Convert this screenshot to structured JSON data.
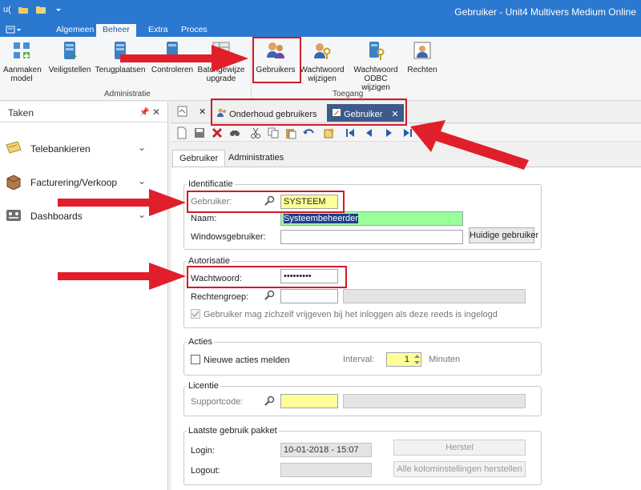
{
  "window": {
    "title": "Gebruiker - Unit4 Multivers Medium Online"
  },
  "quick_access": {
    "logo": "u("
  },
  "ribbon_tabs": [
    "Algemeen",
    "Beheer",
    "Extra",
    "Proces"
  ],
  "ribbon_active_tab": "Beheer",
  "ribbon": {
    "groups": [
      {
        "label": "Administratie"
      },
      {
        "label": "Toegang"
      }
    ],
    "buttons": [
      {
        "label_lines": [
          "Aanmaken",
          "model"
        ],
        "icon": "model-icon"
      },
      {
        "label_lines": [
          "Veiligstellen"
        ],
        "icon": "backup-icon"
      },
      {
        "label_lines": [
          "Terugplaatsen"
        ],
        "icon": "restore-icon"
      },
      {
        "label_lines": [
          "Controleren"
        ],
        "icon": "check-icon"
      },
      {
        "label_lines": [
          "Batchgewijze",
          "upgrade"
        ],
        "icon": "batch-upgrade-icon"
      },
      {
        "label_lines": [
          "Gebruikers"
        ],
        "icon": "users-icon"
      },
      {
        "label_lines": [
          "Wachtwoord",
          "wijzigen"
        ],
        "icon": "password-key-icon"
      },
      {
        "label_lines": [
          "Wachtwoord",
          "ODBC wijzigen"
        ],
        "icon": "odbc-key-icon"
      },
      {
        "label_lines": [
          "Rechten"
        ],
        "icon": "rights-icon"
      }
    ]
  },
  "left_panel": {
    "title": "Taken",
    "items": [
      {
        "label": "Telebankieren",
        "icon": "telebanking-icon"
      },
      {
        "label": "Facturering/Verkoop",
        "icon": "invoice-box-icon"
      },
      {
        "label": "Dashboards",
        "icon": "dashboard-icon"
      }
    ]
  },
  "doc_tabs": [
    {
      "label": "Onderhoud gebruikers",
      "active": false
    },
    {
      "label": "Gebruiker",
      "active": true
    }
  ],
  "sub_tabs": [
    {
      "label": "Gebruiker",
      "active": true
    },
    {
      "label": "Administraties",
      "active": false
    }
  ],
  "form": {
    "identificatie": {
      "title": "Identificatie",
      "gebruiker_label": "Gebruiker:",
      "gebruiker_value": "SYSTEEM",
      "naam_label": "Naam:",
      "naam_value": "Systeembeheerder",
      "windows_label": "Windowsgebruiker:",
      "windows_value": "",
      "huidige_button": "Huidige gebruiker"
    },
    "autorisatie": {
      "title": "Autorisatie",
      "wachtwoord_label": "Wachtwoord:",
      "wachtwoord_value": "•••••••••",
      "rechtengroep_label": "Rechtengroep:",
      "rechtengroep_value": "",
      "checkbox_label": "Gebruiker mag zichzelf vrijgeven bij het inloggen als deze reeds is ingelogd",
      "checkbox_checked": true
    },
    "acties": {
      "title": "Acties",
      "checkbox_label": "Nieuwe acties melden",
      "checkbox_checked": false,
      "interval_label": "Interval:",
      "interval_value": "1",
      "minuten_label": "Minuten"
    },
    "licentie": {
      "title": "Licentie",
      "supportcode_label": "Supportcode:",
      "supportcode_value": ""
    },
    "laatste": {
      "title": "Laatste gebruik pakket",
      "login_label": "Login:",
      "login_value": "10-01-2018 - 15:07",
      "logout_label": "Logout:",
      "logout_value": "",
      "herstel_button": "Herstel",
      "kolom_button": "Alle kolominstellingen herstellen"
    }
  },
  "colors": {
    "titlebar": "#2b78d0",
    "highlight": "#d11a2a",
    "yellow_field": "#ffff99",
    "green_field": "#99ff99",
    "active_doc_tab": "#3c5a8a"
  }
}
